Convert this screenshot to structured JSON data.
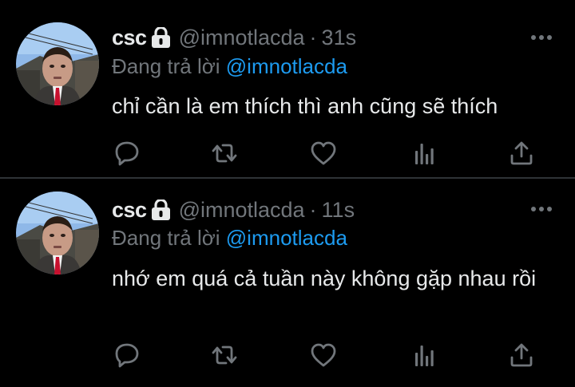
{
  "tweets": [
    {
      "display_name": "csc",
      "handle": "@imnotlacda",
      "separator": "·",
      "time": "31s",
      "replying_prefix": "Đang trả lời ",
      "replying_to": "@imnotlacda",
      "text": "chỉ cần là em thích thì anh cũng sẽ thích"
    },
    {
      "display_name": "csc",
      "handle": "@imnotlacda",
      "separator": "·",
      "time": "11s",
      "replying_prefix": "Đang trả lời ",
      "replying_to": "@imnotlacda",
      "text": "nhớ em quá cả tuần này không gặp nhau rồi"
    }
  ],
  "icons": {
    "lock": "lock-icon",
    "more": "more-icon",
    "reply": "reply-icon",
    "retweet": "retweet-icon",
    "like": "heart-icon",
    "views": "views-icon",
    "share": "share-icon"
  },
  "colors": {
    "background": "#000000",
    "text": "#e7e9ea",
    "secondary": "#71767b",
    "mention": "#1d9bf0",
    "divider": "#2f3336"
  }
}
